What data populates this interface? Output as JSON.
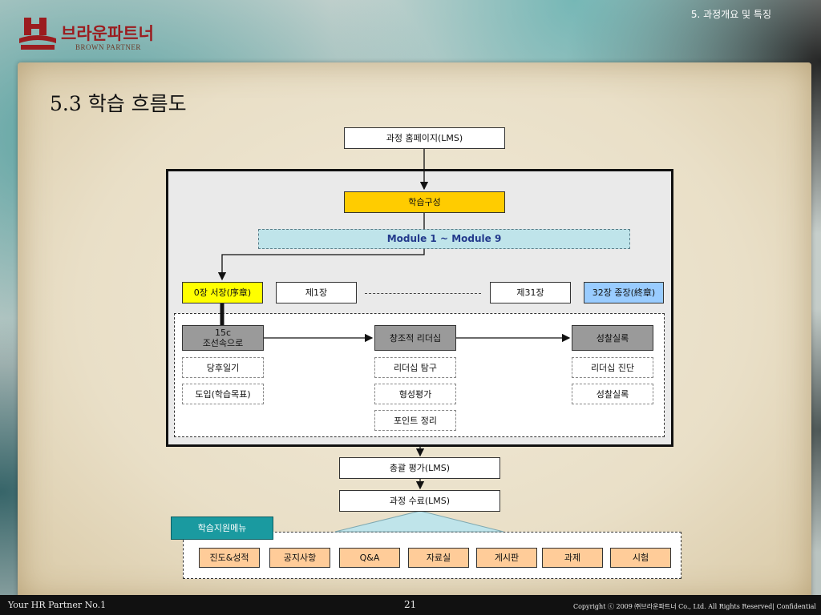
{
  "header": {
    "logo_kr": "브라운파트너",
    "logo_en": "BROWN PARTNER",
    "section_note": "5. 과정개요 및 특징",
    "title": "5.3 학습 흐름도"
  },
  "flow": {
    "homepage": "과정 홈페이지(LMS)",
    "composition": "학습구성",
    "module": "Module 1 ~ Module 9",
    "prologue": "0장 서장(序章)",
    "ch1": "제1장",
    "ch31": "제31장",
    "epilogue": "32장 종장(終章)",
    "col1": {
      "main_line1": "15c",
      "main_line2": "조선속으로",
      "items": [
        "당후일기",
        "도입(학습목표)"
      ]
    },
    "col2": {
      "main": "창조적 리더십",
      "items": [
        "리더십 탐구",
        "형성평가",
        "포인트 정리"
      ]
    },
    "col3": {
      "main": "성찰실록",
      "items": [
        "리더십 진단",
        "성찰실록"
      ]
    },
    "summary_eval": "총괄 평가(LMS)",
    "completion": "과정 수료(LMS)",
    "support_menu_title": "학습지원메뉴",
    "support_menu": [
      "진도&성적",
      "공지사항",
      "Q&A",
      "자료실",
      "게시판",
      "과제",
      "시험"
    ]
  },
  "footer": {
    "left": "Your HR Partner No.1",
    "page": "21",
    "right": "Copyright ⓒ 2009 ㈜브라운파트너 Co., Ltd. All Rights Reserved| Confidential"
  },
  "colors": {
    "composition_fill": "#ffcc00",
    "module_fill": "#bfe4ea",
    "prologue_fill": "#ffff00",
    "epilogue_fill": "#99ccff",
    "step_fill": "#9a9a9a",
    "support_fill": "#ffcc99",
    "support_title_fill": "#1a9aa0",
    "footer_bg": "#111111"
  }
}
